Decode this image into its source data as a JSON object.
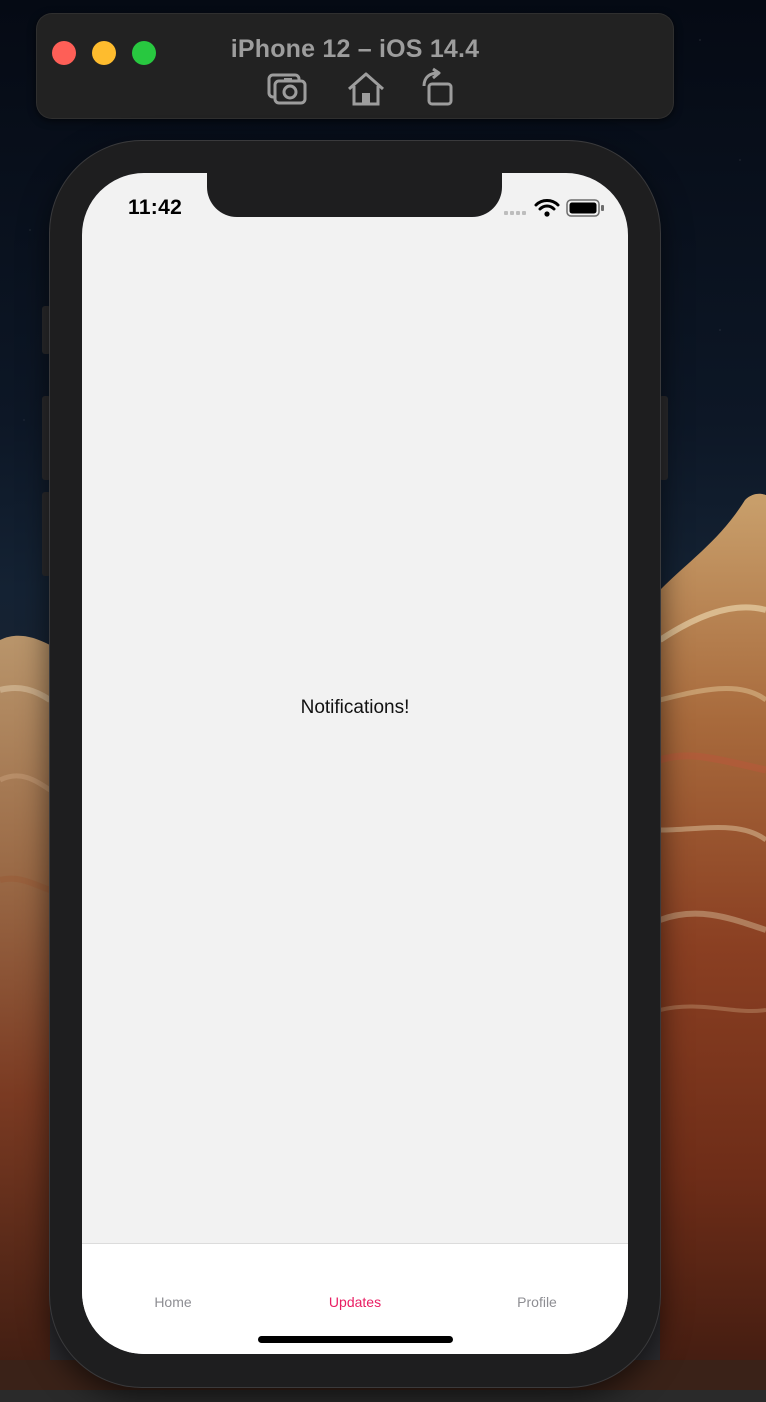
{
  "simulator": {
    "title": "iPhone 12 – iOS 14.4",
    "toolbar_icons": [
      "screenshot-icon",
      "home-icon",
      "rotate-icon"
    ]
  },
  "status_bar": {
    "time": "11:42",
    "icons": [
      "signal-icon",
      "wifi-icon",
      "battery-icon"
    ]
  },
  "screen": {
    "content_text": "Notifications!"
  },
  "tab_bar": {
    "tabs": [
      {
        "label": "Home",
        "active": false
      },
      {
        "label": "Updates",
        "active": true
      },
      {
        "label": "Profile",
        "active": false
      }
    ],
    "active_color": "#e91e63",
    "inactive_color": "#8e8e93"
  }
}
